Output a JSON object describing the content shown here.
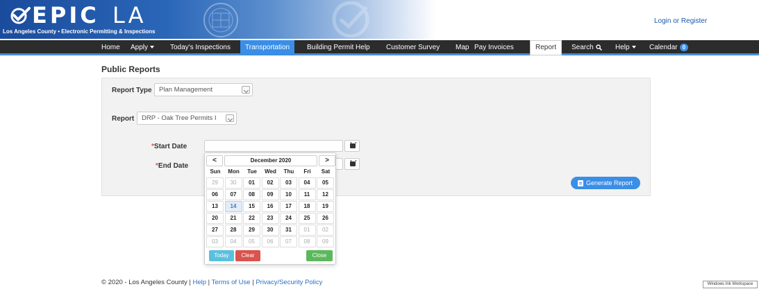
{
  "header": {
    "logo_epic": "EPIC",
    "logo_la": "LA",
    "logo_subtitle": "Los Angeles County • Electronic Permitting & Inspections",
    "login_link": "Login or Register"
  },
  "nav": {
    "items": [
      {
        "label": "Home",
        "dropdown": false
      },
      {
        "label": "Apply",
        "dropdown": true
      },
      {
        "label": "Today's Inspections",
        "dropdown": false
      },
      {
        "label": "Transportation",
        "dropdown": false,
        "state": "highlight"
      },
      {
        "label": "Building Permit Help",
        "dropdown": false
      },
      {
        "label": "Customer Survey",
        "dropdown": false
      },
      {
        "label": "Map",
        "dropdown": false
      },
      {
        "label": "Pay Invoices",
        "dropdown": false
      },
      {
        "label": "Report",
        "dropdown": false,
        "state": "current"
      },
      {
        "label": "Search",
        "dropdown": false,
        "icon": "search-icon"
      },
      {
        "label": "Help",
        "dropdown": true
      },
      {
        "label": "Calendar",
        "dropdown": false,
        "badge": "0"
      }
    ]
  },
  "page": {
    "title": "Public Reports"
  },
  "form": {
    "report_type_label": "Report Type",
    "report_type_value": "Plan Management",
    "report_label": "Report",
    "report_value": "DRP - Oak Tree Permits I",
    "start_date_label": "Start Date",
    "end_date_label": "End Date",
    "required_mark": "*",
    "start_date_value": "",
    "end_date_value": "",
    "generate_label": "Generate Report"
  },
  "datepicker": {
    "prev": "<",
    "next": ">",
    "month_title": "December 2020",
    "weekdays": [
      "Sun",
      "Mon",
      "Tue",
      "Wed",
      "Thu",
      "Fri",
      "Sat"
    ],
    "weeks": [
      [
        {
          "d": "29",
          "m": true
        },
        {
          "d": "30",
          "m": true
        },
        {
          "d": "01"
        },
        {
          "d": "02"
        },
        {
          "d": "03"
        },
        {
          "d": "04"
        },
        {
          "d": "05"
        }
      ],
      [
        {
          "d": "06"
        },
        {
          "d": "07"
        },
        {
          "d": "08"
        },
        {
          "d": "09"
        },
        {
          "d": "10"
        },
        {
          "d": "11"
        },
        {
          "d": "12"
        }
      ],
      [
        {
          "d": "13"
        },
        {
          "d": "14",
          "today": true
        },
        {
          "d": "15"
        },
        {
          "d": "16"
        },
        {
          "d": "17"
        },
        {
          "d": "18"
        },
        {
          "d": "19"
        }
      ],
      [
        {
          "d": "20"
        },
        {
          "d": "21"
        },
        {
          "d": "22"
        },
        {
          "d": "23"
        },
        {
          "d": "24"
        },
        {
          "d": "25"
        },
        {
          "d": "26"
        }
      ],
      [
        {
          "d": "27"
        },
        {
          "d": "28"
        },
        {
          "d": "29"
        },
        {
          "d": "30"
        },
        {
          "d": "31"
        },
        {
          "d": "01",
          "m": true
        },
        {
          "d": "02",
          "m": true
        }
      ],
      [
        {
          "d": "03",
          "m": true
        },
        {
          "d": "04",
          "m": true
        },
        {
          "d": "05",
          "m": true
        },
        {
          "d": "06",
          "m": true
        },
        {
          "d": "07",
          "m": true
        },
        {
          "d": "08",
          "m": true
        },
        {
          "d": "09",
          "m": true
        }
      ]
    ],
    "today_label": "Today",
    "clear_label": "Clear",
    "close_label": "Close"
  },
  "footer": {
    "copyright": "© 2020 - Los Angeles County | ",
    "help": "Help",
    "sep1": " | ",
    "terms": "Terms of Use",
    "sep2": " | ",
    "privacy": "Privacy/Security Policy"
  },
  "system": {
    "ink_workspace": "Windows Ink Workspace"
  },
  "colors": {
    "nav_bg": "#2c2c2c",
    "accent": "#3a8ee6",
    "clear_btn": "#d9534f",
    "close_btn": "#5cb85c",
    "today_btn": "#5bc0de"
  }
}
